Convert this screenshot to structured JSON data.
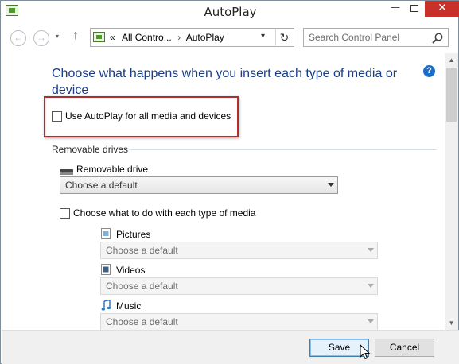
{
  "window": {
    "title": "AutoPlay"
  },
  "titlebar": {
    "minimize": "—",
    "close": "✕"
  },
  "nav": {
    "breadcrumb_prefix": "«",
    "breadcrumbs": [
      "All Contro...",
      "AutoPlay"
    ],
    "search_placeholder": "Search Control Panel"
  },
  "main": {
    "heading": "Choose what happens when you insert each type of media or device",
    "help": "?",
    "use_autoplay": {
      "label": "Use AutoPlay for all media and devices",
      "checked": false
    },
    "section_label": "Removable drives",
    "removable_drive": {
      "label": "Removable drive",
      "selected": "Choose a default"
    },
    "each_type": {
      "label": "Choose what to do with each type of media",
      "checked": false
    },
    "media_types": [
      {
        "label": "Pictures",
        "icon": "pictures-icon",
        "selected": "Choose a default"
      },
      {
        "label": "Videos",
        "icon": "videos-icon",
        "selected": "Choose a default"
      },
      {
        "label": "Music",
        "icon": "music-icon",
        "selected": "Choose a default"
      }
    ]
  },
  "footer": {
    "save_label": "Save",
    "cancel_label": "Cancel"
  },
  "colors": {
    "heading": "#1a3e86",
    "highlight_border": "#b42b2b",
    "close_button": "#c7312a",
    "help_icon": "#1d6cc6"
  }
}
